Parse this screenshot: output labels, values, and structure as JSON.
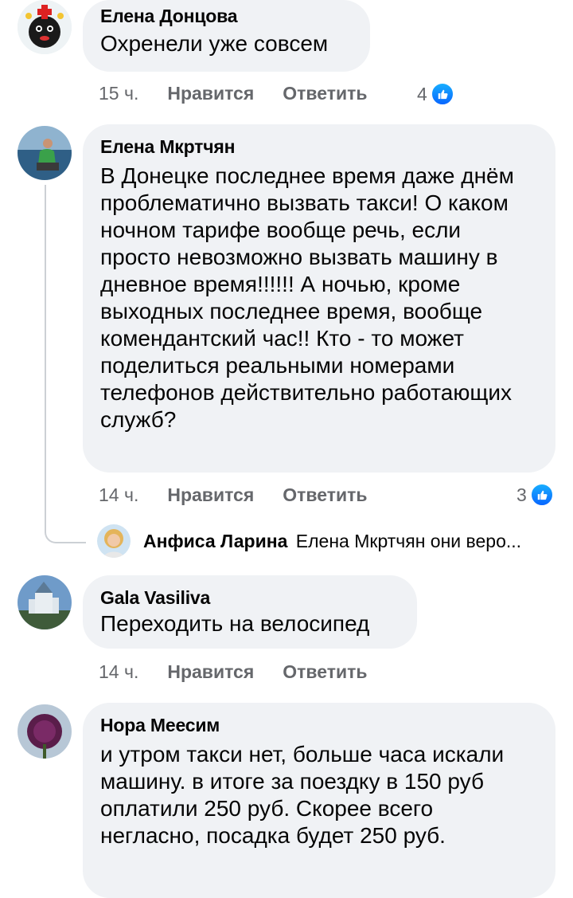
{
  "comments": [
    {
      "author": "Елена Донцова",
      "text": "Охренели уже совсем",
      "time": "15 ч.",
      "like_label": "Нравится",
      "reply_label": "Ответить",
      "reaction_count": "4"
    },
    {
      "author": "Елена Мкртчян",
      "text": "В Донецке последнее время даже днём проблематично вызвать такси! О каком ночном тарифе вообще речь, если просто невозможно вызвать машину в дневное время!!!!!! А ночью, кроме выходных последнее время, вообще комендантский час!! Кто - то может поделиться реальными номерами телефонов действительно работающих служб?",
      "time": "14 ч.",
      "like_label": "Нравится",
      "reply_label": "Ответить",
      "reaction_count": "3",
      "reply_preview": {
        "author": "Анфиса Ларина",
        "text": "Елена Мкртчян они веро..."
      }
    },
    {
      "author": "Gala Vasiliva",
      "text": "Переходить на велосипед",
      "time": "14 ч.",
      "like_label": "Нравится",
      "reply_label": "Ответить"
    },
    {
      "author": "Нора Меесим",
      "text": "и утром такси нет, больше часа искали машину. в итоге за поездку в 150 руб оплатили 250 руб. Скорее всего негласно, посадка будет 250 руб."
    }
  ],
  "colors": {
    "bubble": "#f0f2f5",
    "meta_text": "#65676b",
    "like_blue": "#0866ff"
  },
  "icons": [
    "like-reaction-icon"
  ]
}
